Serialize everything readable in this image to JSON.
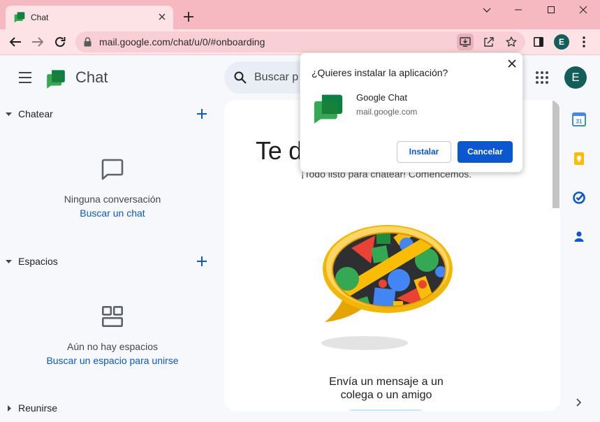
{
  "browser": {
    "tab": {
      "title": "Chat",
      "favicon": "google-chat-logo-icon"
    },
    "omnibox": {
      "url": "mail.google.com/chat/u/0/#onboarding"
    },
    "profile_initial": "E"
  },
  "header": {
    "app_name": "Chat",
    "search_placeholder": "Buscar p",
    "account_initial": "E"
  },
  "sidebar": {
    "sections": [
      {
        "title": "Chatear",
        "expanded": true,
        "icon": "chat-bubble-outline-icon",
        "empty_message": "Ninguna conversación",
        "link": "Buscar un chat"
      },
      {
        "title": "Espacios",
        "expanded": true,
        "icon": "spaces-icon",
        "empty_message": "Aún no hay espacios",
        "link": "Buscar un espacio para unirse"
      },
      {
        "title": "Reunirse",
        "expanded": false
      }
    ]
  },
  "main": {
    "welcome_title": "Te d",
    "subtitle": "¡Todo listo para chatear! Comencemos.",
    "illustration": "chat-bubble-blocks-illustration",
    "message_lines": [
      "Envía un mensaje a un",
      "colega o un amigo"
    ]
  },
  "side_panel": {
    "apps": [
      "calendar-icon",
      "keep-icon",
      "tasks-icon",
      "contacts-icon"
    ],
    "calendar_day": "31"
  },
  "install_dialog": {
    "title": "¿Quieres instalar la aplicación?",
    "app_name": "Google Chat",
    "app_domain": "mail.google.com",
    "install_label": "Instalar",
    "cancel_label": "Cancelar"
  },
  "colors": {
    "frame": "#f6b8c1",
    "toolbar": "#fde2e6",
    "page_background": "#f6f8fc",
    "accent": "#0b57d0",
    "avatar": "#135d5a",
    "chat_green": "#34a853"
  }
}
